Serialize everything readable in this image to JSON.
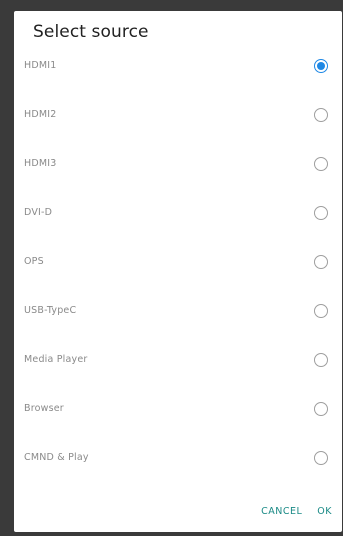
{
  "dialog": {
    "title": "Select source",
    "options": [
      {
        "label": "HDMI1",
        "selected": true
      },
      {
        "label": "HDMI2",
        "selected": false
      },
      {
        "label": "HDMI3",
        "selected": false
      },
      {
        "label": "DVI-D",
        "selected": false
      },
      {
        "label": "OPS",
        "selected": false
      },
      {
        "label": "USB-TypeC",
        "selected": false
      },
      {
        "label": "Media Player",
        "selected": false
      },
      {
        "label": "Browser",
        "selected": false
      },
      {
        "label": "CMND & Play",
        "selected": false
      }
    ],
    "cancel_label": "CANCEL",
    "ok_label": "OK"
  },
  "colors": {
    "accent": "#1e88e5",
    "action_text": "#1a8a86",
    "backdrop": "#3a3a3a"
  }
}
